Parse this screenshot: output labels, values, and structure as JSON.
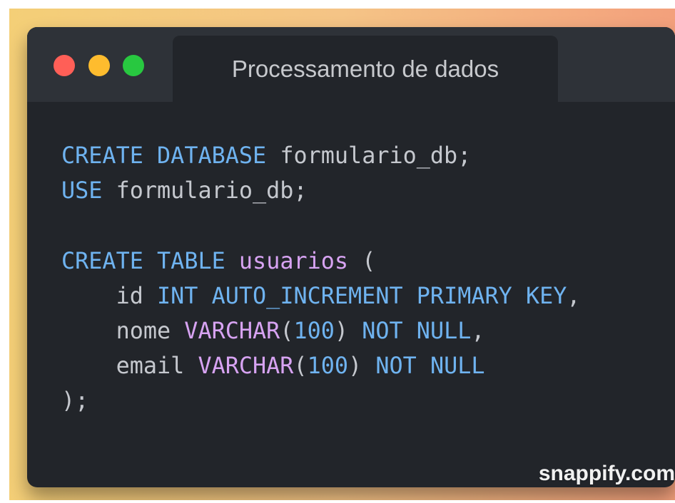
{
  "window": {
    "title": "Processamento de dados",
    "controls": {
      "close_color": "#ff5f57",
      "minimize_color": "#febc2e",
      "maximize_color": "#28c840"
    }
  },
  "code": {
    "language": "sql",
    "lines": [
      [
        {
          "t": "CREATE",
          "k": "kw"
        },
        {
          "t": " ",
          "k": "punct"
        },
        {
          "t": "DATABASE",
          "k": "kw"
        },
        {
          "t": " formulario_db;",
          "k": "ident"
        }
      ],
      [
        {
          "t": "USE",
          "k": "kw"
        },
        {
          "t": " formulario_db;",
          "k": "ident"
        }
      ],
      [],
      [
        {
          "t": "CREATE",
          "k": "kw"
        },
        {
          "t": " ",
          "k": "punct"
        },
        {
          "t": "TABLE",
          "k": "kw"
        },
        {
          "t": " ",
          "k": "punct"
        },
        {
          "t": "usuarios",
          "k": "name"
        },
        {
          "t": " (",
          "k": "punct"
        }
      ],
      [
        {
          "t": "    id ",
          "k": "ident"
        },
        {
          "t": "INT",
          "k": "kw"
        },
        {
          "t": " ",
          "k": "punct"
        },
        {
          "t": "AUTO_INCREMENT",
          "k": "kw"
        },
        {
          "t": " ",
          "k": "punct"
        },
        {
          "t": "PRIMARY",
          "k": "kw"
        },
        {
          "t": " ",
          "k": "punct"
        },
        {
          "t": "KEY",
          "k": "kw"
        },
        {
          "t": ",",
          "k": "punct"
        }
      ],
      [
        {
          "t": "    nome ",
          "k": "ident"
        },
        {
          "t": "VARCHAR",
          "k": "type"
        },
        {
          "t": "(",
          "k": "punct"
        },
        {
          "t": "100",
          "k": "num"
        },
        {
          "t": ") ",
          "k": "punct"
        },
        {
          "t": "NOT",
          "k": "kw"
        },
        {
          "t": " ",
          "k": "punct"
        },
        {
          "t": "NULL",
          "k": "kw"
        },
        {
          "t": ",",
          "k": "punct"
        }
      ],
      [
        {
          "t": "    email ",
          "k": "ident"
        },
        {
          "t": "VARCHAR",
          "k": "type"
        },
        {
          "t": "(",
          "k": "punct"
        },
        {
          "t": "100",
          "k": "num"
        },
        {
          "t": ") ",
          "k": "punct"
        },
        {
          "t": "NOT",
          "k": "kw"
        },
        {
          "t": " ",
          "k": "punct"
        },
        {
          "t": "NULL",
          "k": "kw"
        }
      ],
      [
        {
          "t": ");",
          "k": "punct"
        }
      ]
    ]
  },
  "colors": {
    "background_gradient": [
      "#f4cf77",
      "#f5c486",
      "#f3a07c"
    ],
    "window_bg": "#22252a",
    "titlebar_bg": "#2e3238",
    "keyword": "#6fb3f0",
    "type": "#d7a3f2",
    "text": "#c5c8ce"
  },
  "watermark": {
    "text": "snappify.com"
  }
}
